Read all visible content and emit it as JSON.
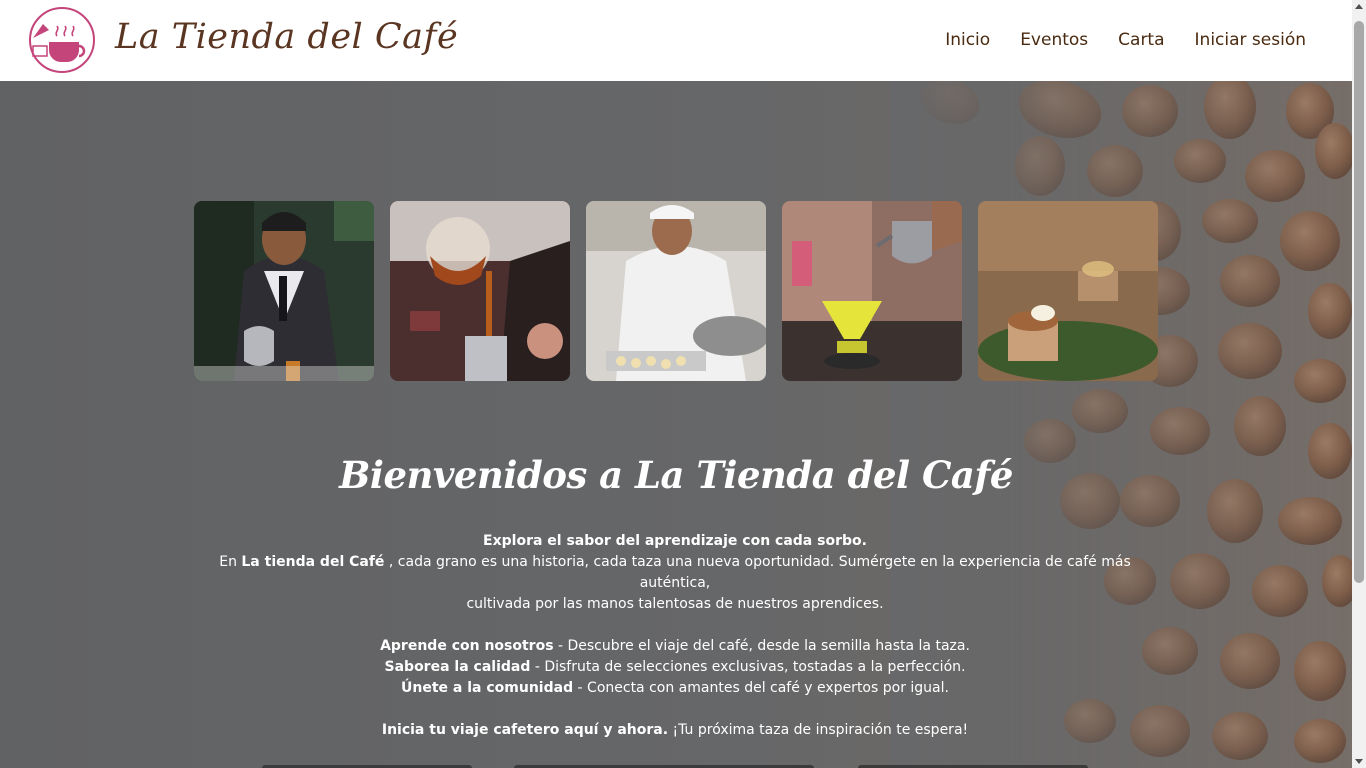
{
  "header": {
    "brand": "La Tienda del Café",
    "nav": [
      {
        "label": "Inicio"
      },
      {
        "label": "Eventos"
      },
      {
        "label": "Carta"
      },
      {
        "label": "Iniciar sesión"
      }
    ]
  },
  "hero": {
    "gallery": [
      {
        "icon": "barista-pouring-photo"
      },
      {
        "icon": "coffee-siphon-photo"
      },
      {
        "icon": "chef-baking-photo"
      },
      {
        "icon": "pour-over-kettle-photo"
      },
      {
        "icon": "gourmet-dish-photo"
      }
    ],
    "title": "Bienvenidos a La Tienda del Café",
    "intro_bold": "Explora el sabor del aprendizaje con cada sorbo.",
    "line2_prefix": "En ",
    "line2_bold": "La tienda del Café",
    "line2_rest": " , cada grano es una historia, cada taza una nueva oportunidad. Sumérgete en la experiencia de café más auténtica,",
    "line3": "cultivada por las manos talentosas de nuestros aprendices.",
    "bullets": [
      {
        "bold": "Aprende con nosotros",
        "text": " - Descubre el viaje del café, desde la semilla hasta la taza."
      },
      {
        "bold": "Saborea la calidad",
        "text": " - Disfruta de selecciones exclusivas, tostadas a la perfección."
      },
      {
        "bold": "Únete a la comunidad",
        "text": " - Conecta con amantes del café y expertos por igual."
      }
    ],
    "cta_bold": "Inicia tu viaje cafetero aquí y ahora.",
    "cta_text": " ¡Tu próxima taza de inspiración te espera!"
  },
  "colors": {
    "brand": "#5a3521",
    "logo": "#c4457a"
  }
}
